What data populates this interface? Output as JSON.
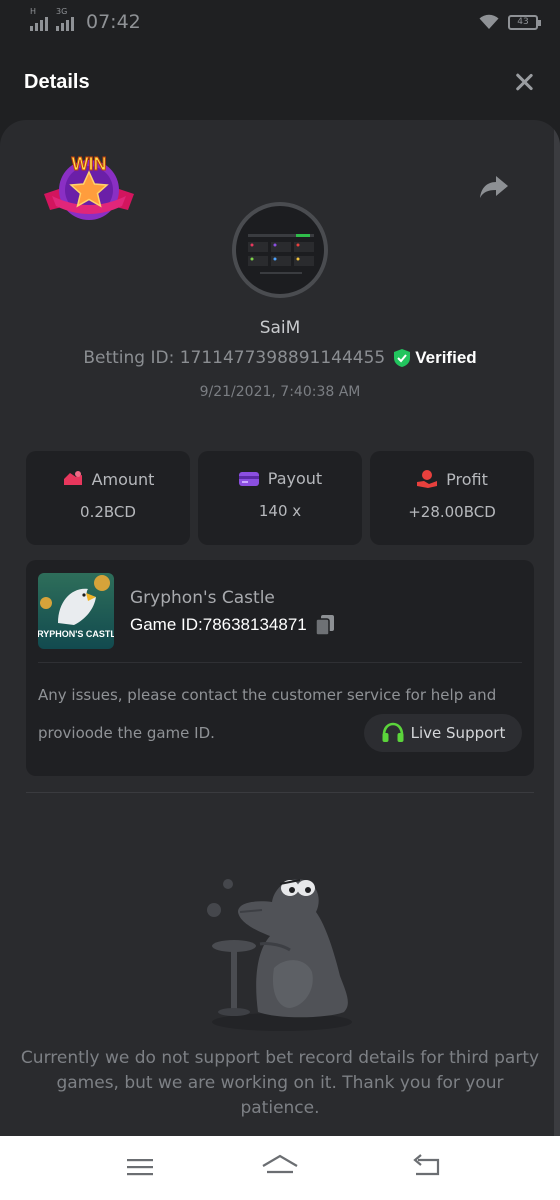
{
  "status_bar": {
    "time": "07:42",
    "network_label_1": "H",
    "network_label_2": "3G",
    "battery": "43"
  },
  "header": {
    "title": "Details"
  },
  "win_badge": {
    "text": "WIN"
  },
  "bet": {
    "user_name": "SaiM",
    "betting_id": "Betting ID: 1711477398891144455",
    "verified_label": "Verified",
    "datetime": "9/21/2021, 7:40:38 AM"
  },
  "stats": [
    {
      "label": "Amount",
      "value": "0.2BCD",
      "icon": "amount-icon",
      "color": "#e8375d"
    },
    {
      "label": "Payout",
      "value": "140 x",
      "icon": "payout-icon",
      "color": "#8b4fe0"
    },
    {
      "label": "Profit",
      "value": "+28.00BCD",
      "icon": "profit-icon",
      "color": "#e8403d"
    }
  ],
  "game": {
    "name": "Gryphon's Castle",
    "thumbnail_text": "GRYPHON'S CASTLE",
    "game_id": "Game ID:78638134871",
    "issue_text": "Any issues, please contact the customer service for help and provioode the game ID.",
    "support_label": "Live Support"
  },
  "notice": "Currently we do not support bet record details for third party games, but we are working on it. Thank you for your patience.",
  "colors": {
    "verified_green": "#22c55e",
    "support_green": "#5bd43b",
    "background": "#1f2022",
    "panel": "#2a2b2e"
  },
  "nav_icons": [
    "menu-icon",
    "home-icon",
    "back-icon"
  ]
}
